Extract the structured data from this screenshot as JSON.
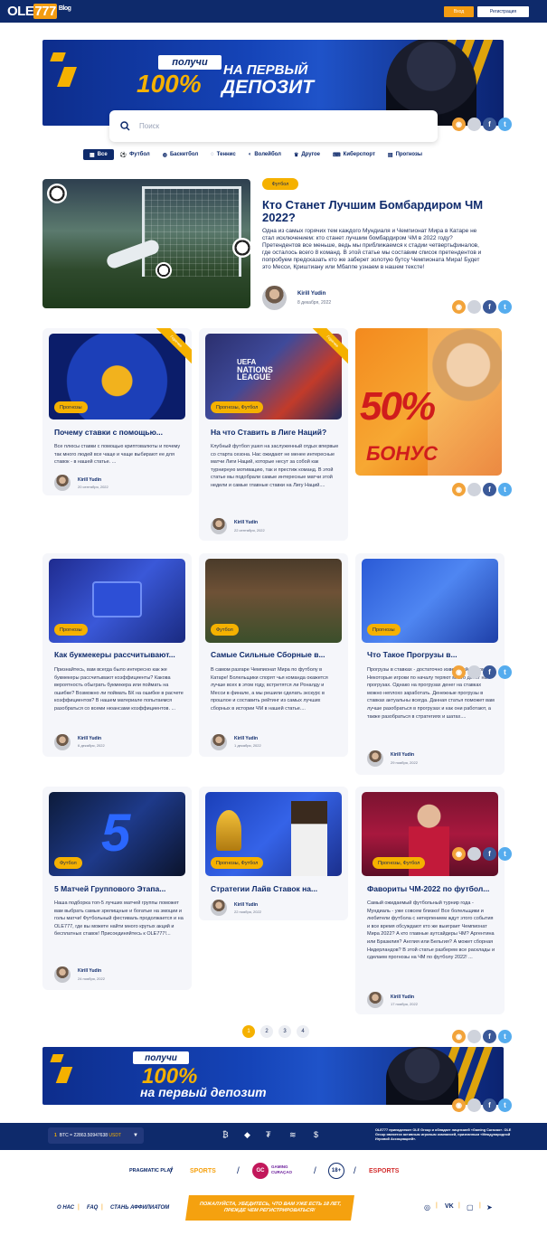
{
  "header": {
    "logo_ole": "OLE",
    "logo_num": "777",
    "logo_blog": "Blog",
    "login": "Вход",
    "register": "Регистрация"
  },
  "banner_top": {
    "pill": "получи",
    "percent": "100%",
    "line1": "НА ПЕРВЫЙ",
    "line2": "ДЕПОЗИТ"
  },
  "search": {
    "placeholder": "Поиск"
  },
  "tabs": [
    {
      "label": "Все",
      "icon": "grid-icon"
    },
    {
      "label": "Футбол",
      "icon": "football-icon"
    },
    {
      "label": "Баскетбол",
      "icon": "basketball-icon"
    },
    {
      "label": "Теннис",
      "icon": "tennis-icon"
    },
    {
      "label": "Волейбол",
      "icon": "volleyball-icon"
    },
    {
      "label": "Другое",
      "icon": "trophy-icon"
    },
    {
      "label": "Киберспорт",
      "icon": "gamepad-icon"
    },
    {
      "label": "Прогнозы",
      "icon": "forecast-icon"
    }
  ],
  "hero": {
    "category": "Футбол",
    "title": "Кто Станет Лучшим Бомбардиром ЧМ 2022?",
    "desc": "Одна из самых горячих тем каждого Мундиаля и Чемпионат Мира в Катаре не стал исключением: кто станет лучшим бомбардиром ЧМ в 2022 году? Претендентов все меньше, ведь мы приближаемся к стадии четвертьфиналов, где осталось всего 8 команд. В этой статье мы составим список претендентов и попробуем предсказать кто же заберет золотую бутсу Чемпионата Мира! Будет это Месси, Криштиану или Мбаппе узнаем в нашем тексте!",
    "author": "Kirill Yudin",
    "date": "8 декабря, 2022"
  },
  "cards": [
    {
      "category": "Прогнозы",
      "title": "Почему ставки с помощью...",
      "desc": "Все плюсы ставки с помощью криптовалюты и почему так много людей все чаще и чаще выбирают ее для ставок - в нашей статье. ...",
      "author": "Kirill Yudin",
      "date": "20 сентября, 2022",
      "ribbon": "Горячее"
    },
    {
      "category": "Прогнозы, Футбол",
      "title": "На что Ставить в Лиге Наций?",
      "desc": "Клубный футбол ушел на заслуженный отдых впервые со старта сезона. Нас ожидают не менее интересные матчи Лиги Наций, которые несут за собой как турнирную мотивацию, так и престиж команд. В этой статье мы подобрали самые интересные матчи этой недели и самые главные ставки на Лигу Наций....",
      "author": "Kirill Yudin",
      "date": "22 сентября, 2022",
      "ribbon": "Горячее",
      "logo_text1": "UEFA",
      "logo_text2": "NATIONS",
      "logo_text3": "LEAGUE"
    },
    {
      "category": "Прогнозы",
      "title": "Как букмекеры рассчитывают...",
      "desc": "Признайтесь, вам всегда было интересно как же букмекеры рассчитывают коэффициенты? Какова вероятность обыграть букмекера или поймать на ошибке? Возможно ли поймать БК на ошибке в расчете коэффициентов? В нашем материале попытаемся разобраться со всеми нюансами коэффициентов. ...",
      "author": "Kirill Yudin",
      "date": "6 декабря, 2022"
    },
    {
      "category": "Футбол",
      "title": "Самые Сильные Сборные в...",
      "desc": "В самом разгаре Чемпионат Мира по футболу в Катаре! Болельщики спорят чья команда окажется лучше всех в этом году, встретятся ли Роналду и Месси в финале, а мы решили сделать экскурс в прошлое и составить рейтинг из самых лучших сборных в истории ЧМ в нашей статье....",
      "author": "Kirill Yudin",
      "date": "1 декабря, 2022"
    },
    {
      "category": "Прогнозы",
      "title": "Что Такое Прогрузы в...",
      "desc": "Прогрузы в ставках - достаточно известный феномен. Некоторые игроки по началу теряют много денег на прогрузах. Однако на прогрузах денег на ставках можно неплохо заработать. Денежные прогрузы в ставках актуальны всегда. Данная статья поможет вам лучше разобраться в прогрузах и как они работают, а также разобраться в стратегиях и шатах....",
      "author": "Kirill Yudin",
      "date": "29 ноября, 2022"
    },
    {
      "category": "Футбол",
      "title": "5 Матчей Группового Этапа...",
      "desc": "Наша подборка топ-5 лучших матчей группы поможет вам выбрать самые зрелищные и богатые на эмоции и голы матчи! Футбольный фестиваль продолжается и на OLE777, где вы можете найти много крутых акций и бесплатных ставок! Присоединяйтесь к OLE777!...",
      "author": "Kirill Yudin",
      "date": "24 ноября, 2022"
    },
    {
      "category": "Прогнозы, Футбол",
      "title": "Стратегии Лайв Ставок на...",
      "desc": "",
      "author": "Kirill Yudin",
      "date": "22 ноября, 2022"
    },
    {
      "category": "Прогнозы, Футбол",
      "title": "Фавориты ЧМ-2022 по футбол...",
      "desc": "Самый ожидаемый футбольный турнир года - Мундиаль - уже совсем близко! Все болельщики и любители футбола с нетерпением ждут этого события и все время обсуждают кто же выиграет Чемпионат Мира 2022? А кто главные аутсайдеры ЧМ? Аргентина или Бразилия? Англия или Бельгия? А может сборная Нидерландов? В этой статье разберем все расклады и сделаем прогнозы на ЧМ по футболу 2022! ...",
      "author": "Kirill Yudin",
      "date": "17 ноября, 2022"
    }
  ],
  "side_banner": {
    "percent": "50%",
    "bonus": "БОНУС"
  },
  "pagination": [
    "1",
    "2",
    "3",
    "4"
  ],
  "banner_bottom": {
    "pill": "получи",
    "percent": "100%",
    "line1": "на первый депозит"
  },
  "footer": {
    "btc_prefix": "1",
    "btc_rate": "BTC = 22863.50947638",
    "btc_unit": "USDT",
    "license": "OLE777 принадлежит OLE Group и обладает лицензией «Gaming Curacao». OLE Group является активным игровым компанией, признанным «Международной Игровой Ассоциацией».",
    "providers": [
      "PRAGMATIC PLAY",
      "SPORTS",
      "GAMING CURAÇAO",
      "18+",
      "ESPORTS"
    ],
    "links": [
      "О НАС",
      "FAQ",
      "СТАНЬ АФФИЛИАТОМ"
    ],
    "warning": "ПОЖАЛУЙСТА, УБЕДИТЕСЬ, ЧТО ВАМ УЖЕ ЕСТЬ 18 ЛЕТ, ПРЕЖДЕ ЧЕМ РЕГИСТРИРОВАТЬСЯ!",
    "coins": [
      "bitcoin-icon",
      "ethereum-icon",
      "tether-icon",
      "litecoin-icon",
      "dollar-icon"
    ],
    "socials": [
      "whatsapp-icon",
      "vk-icon",
      "instagram-icon",
      "telegram-icon"
    ]
  },
  "colors": {
    "navy": "#0e2a6b",
    "accent": "#f5b100",
    "card_bg": "#f5f6fa"
  }
}
